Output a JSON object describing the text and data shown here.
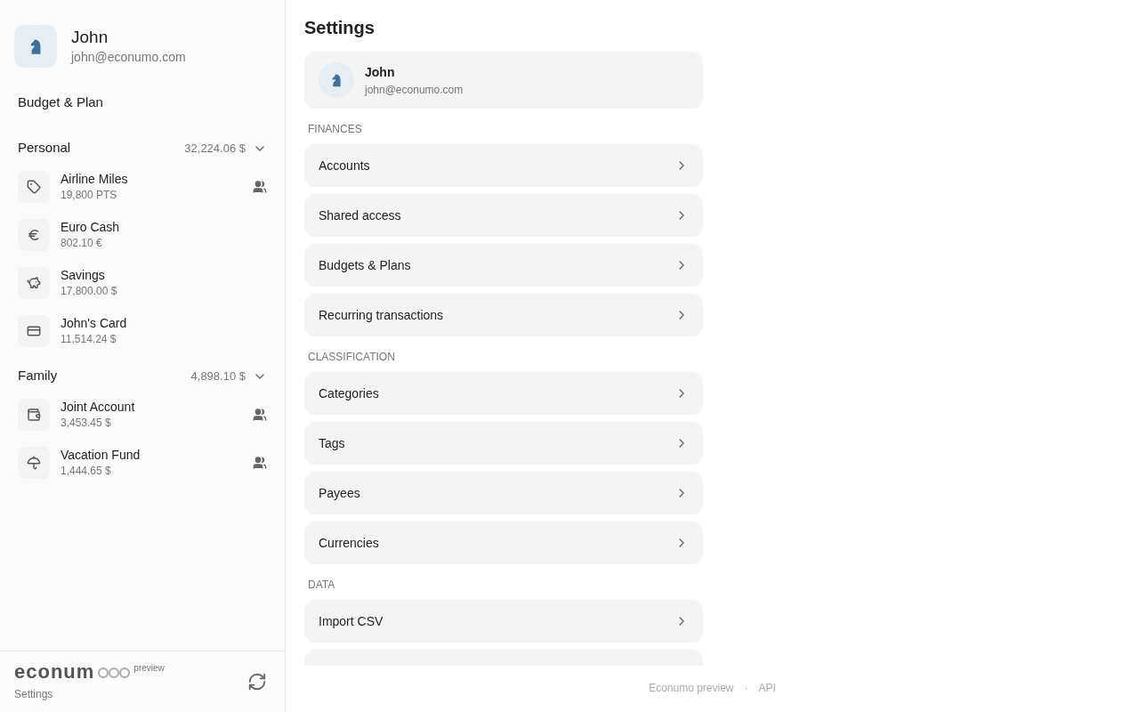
{
  "user": {
    "name": "John",
    "email": "john@econumo.com"
  },
  "sidebar": {
    "budget_link": "Budget & Plan",
    "folders": [
      {
        "name": "Personal",
        "total": "32,224.06 $",
        "expanded": true,
        "accounts": [
          {
            "name": "Airline Miles",
            "balance": "19,800 PTS",
            "kind": "tag",
            "shared": true
          },
          {
            "name": "Euro Cash",
            "balance": "802.10 €",
            "kind": "euro",
            "shared": false
          },
          {
            "name": "Savings",
            "balance": "17,800.00 $",
            "kind": "piggy",
            "shared": false
          },
          {
            "name": "John's Card",
            "balance": "11,514.24 $",
            "kind": "card",
            "shared": false
          }
        ]
      },
      {
        "name": "Family",
        "total": "4,898.10 $",
        "expanded": true,
        "accounts": [
          {
            "name": "Joint Account",
            "balance": "3,453.45 $",
            "kind": "wallet",
            "shared": true
          },
          {
            "name": "Vacation Fund",
            "balance": "1,444.65 $",
            "kind": "umbrella",
            "shared": true
          }
        ]
      }
    ],
    "logo": "econum",
    "logo_badge": "preview",
    "settings_link": "Settings"
  },
  "page": {
    "title": "Settings",
    "profile": {
      "name": "John",
      "email": "john@econumo.com"
    },
    "sections": [
      {
        "heading": "FINANCES",
        "items": [
          "Accounts",
          "Shared access",
          "Budgets & Plans",
          "Recurring transactions"
        ]
      },
      {
        "heading": "CLASSIFICATION",
        "items": [
          "Categories",
          "Tags",
          "Payees",
          "Currencies"
        ]
      },
      {
        "heading": "DATA",
        "items": [
          "Import CSV"
        ],
        "more_below": true
      }
    ]
  },
  "footer": {
    "app": "Econumo preview",
    "separator": "·",
    "api": "API"
  }
}
